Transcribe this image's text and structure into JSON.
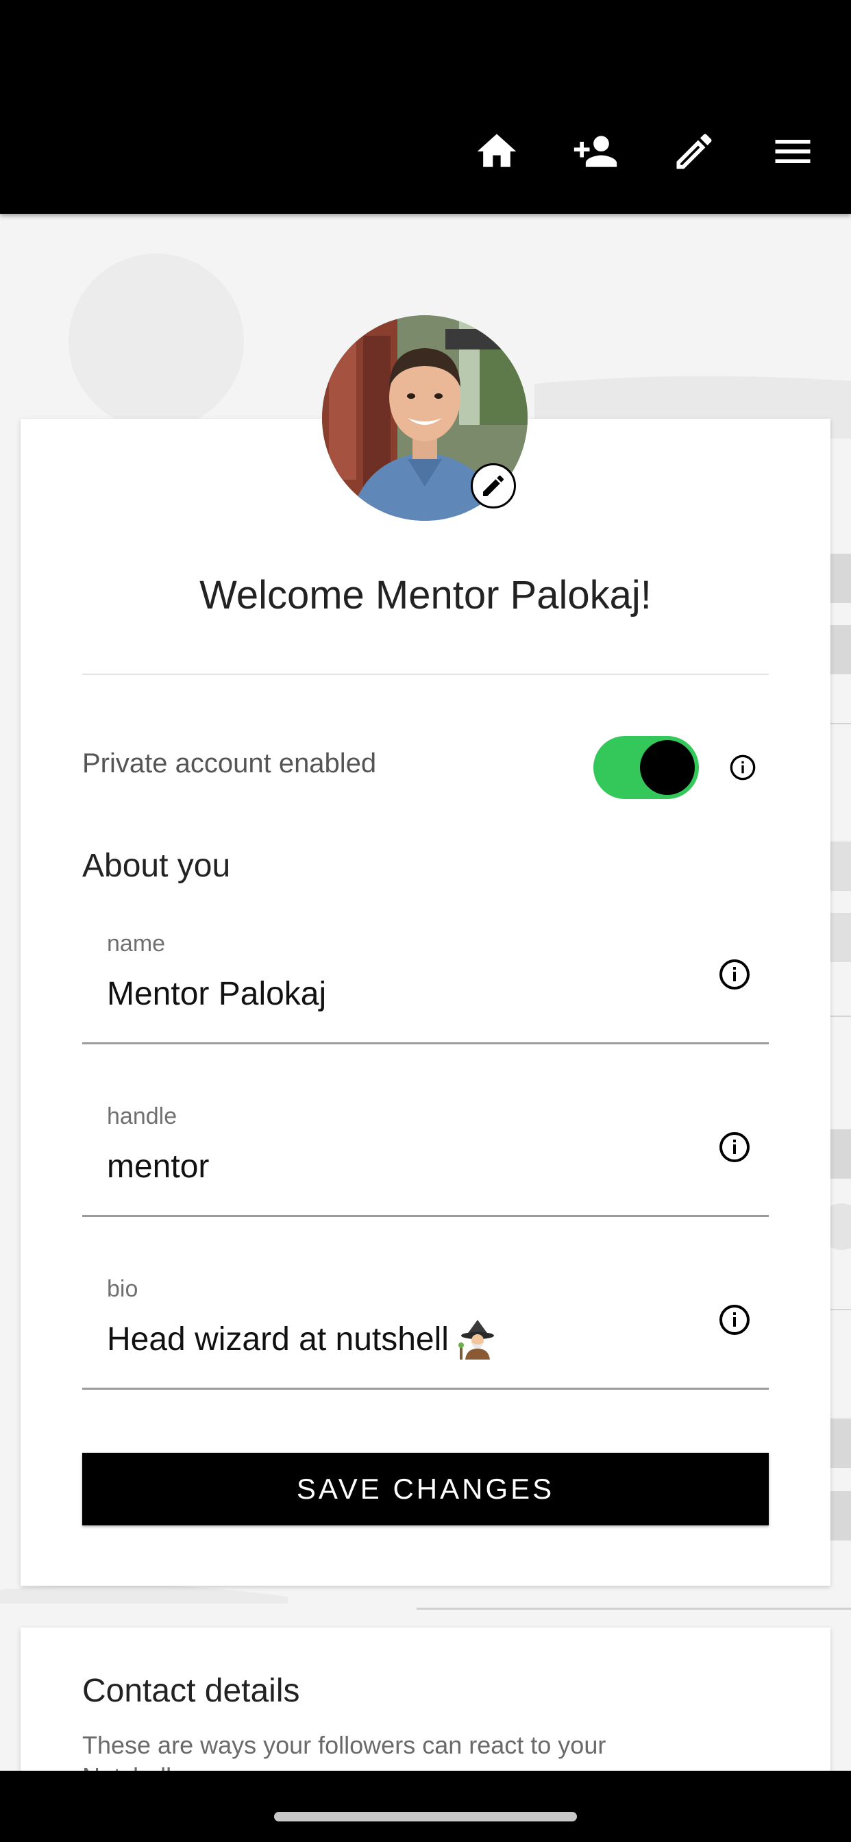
{
  "nav": {
    "icons": [
      "home-icon",
      "add-person-icon",
      "edit-icon",
      "menu-icon"
    ]
  },
  "profile": {
    "welcome": "Welcome Mentor Palokaj!",
    "private_label": "Private account enabled",
    "private_enabled": true,
    "about_title": "About you",
    "fields": {
      "name": {
        "label": "name",
        "value": "Mentor Palokaj"
      },
      "handle": {
        "label": "handle",
        "value": "mentor"
      },
      "bio": {
        "label": "bio",
        "value": "Head wizard at nutshell"
      }
    },
    "save_label": "SAVE CHANGES"
  },
  "contact": {
    "title": "Contact details",
    "subtitle": "These are ways your followers can react to your Nutshells"
  },
  "colors": {
    "topbar": "#000000",
    "toggle_on": "#34c759",
    "button_bg": "#000000",
    "background": "#f4f4f4"
  }
}
